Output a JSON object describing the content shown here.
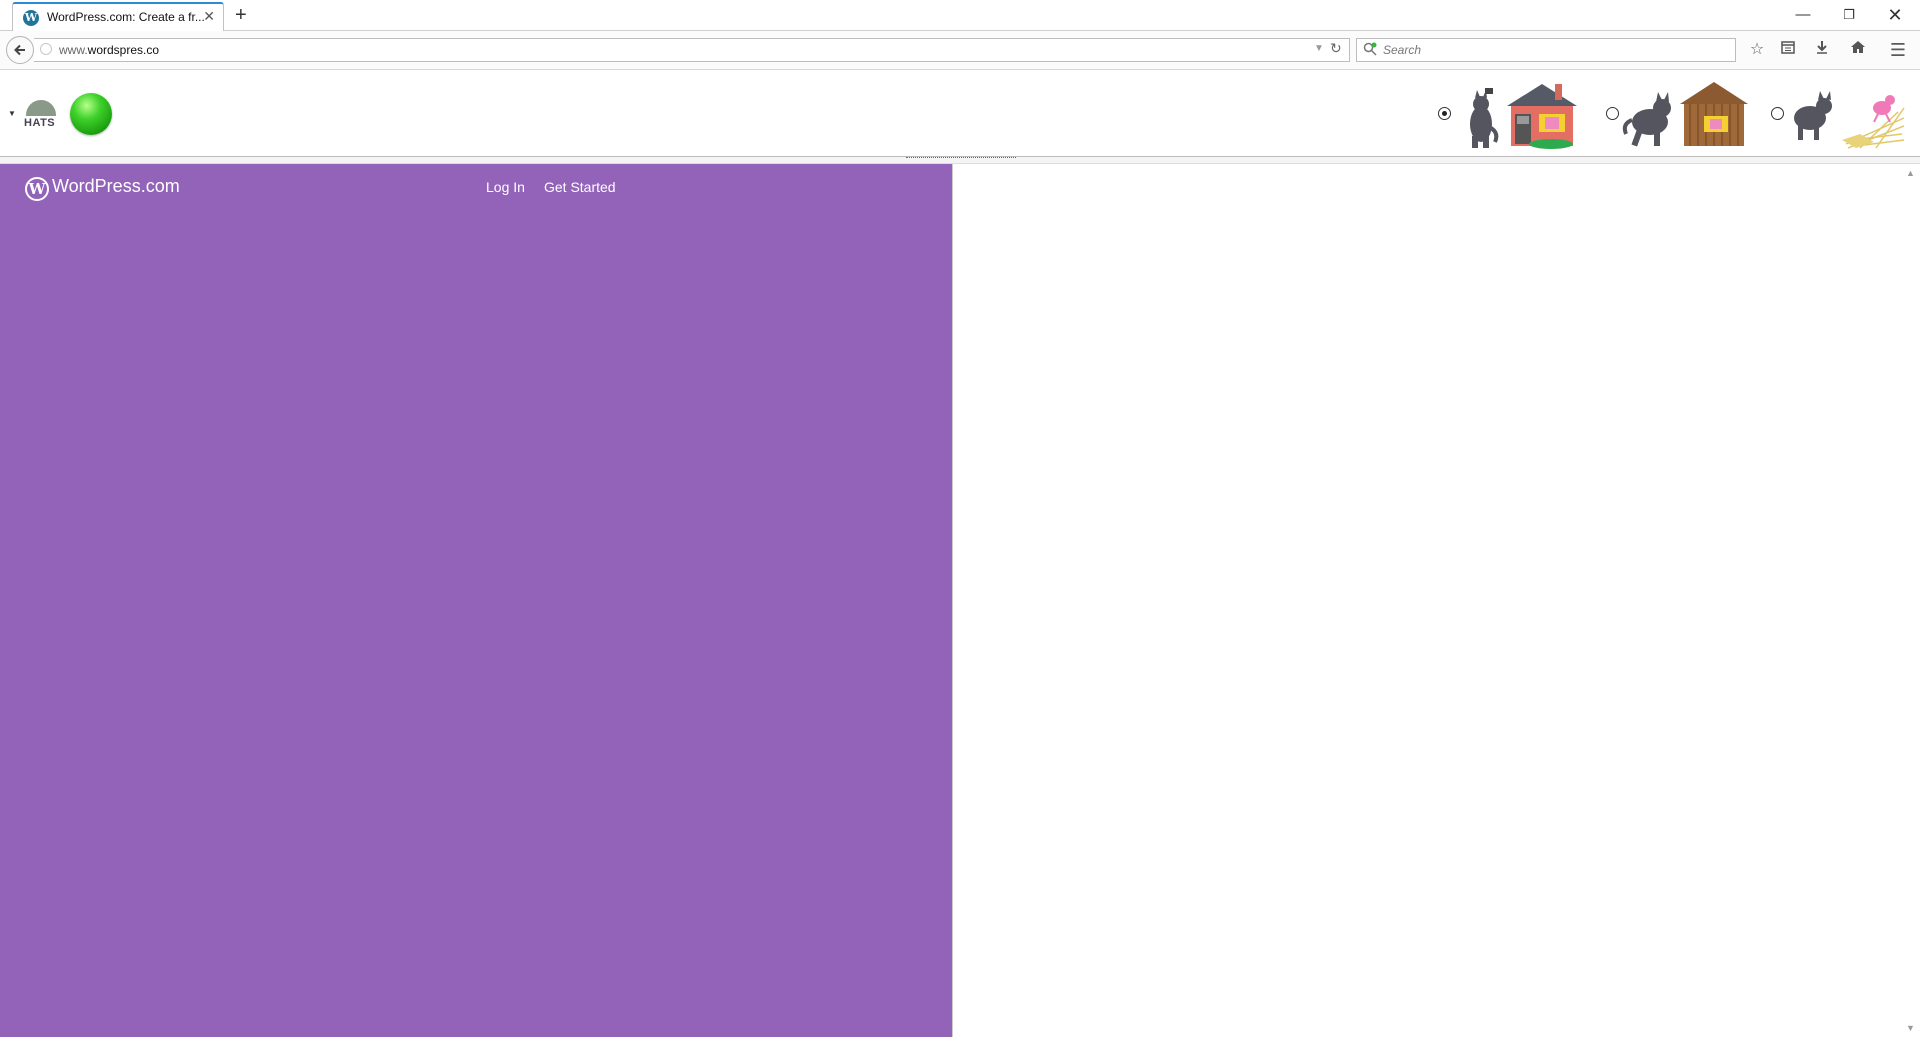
{
  "browser": {
    "tab_title": "WordPress.com: Create a fr...",
    "tab_favicon": "W",
    "tab_close": "✕",
    "new_tab": "+",
    "window_controls": {
      "minimize": "—",
      "restore": "❐",
      "close": "✕"
    },
    "url_prefix": "www.",
    "url_domain": "wordspres.co",
    "search_placeholder": "Search"
  },
  "extension_toolbar": {
    "hats_label": "HATS",
    "scene_options": [
      {
        "name": "wolf-brick-house",
        "selected": true
      },
      {
        "name": "wolf-wood-house",
        "selected": false
      },
      {
        "name": "wolf-straw-house",
        "selected": false
      }
    ]
  },
  "page": {
    "brand": "WordPress.com",
    "logo_letter": "W",
    "nav": {
      "login": "Log In",
      "get_started": "Get Started"
    },
    "left_bg_color": "#9363ba"
  },
  "icons": {
    "back": "back-arrow-icon",
    "reload": "reload-icon",
    "star": "bookmark-star-icon",
    "library": "library-icon",
    "download": "download-icon",
    "home": "home-icon",
    "menu": "hamburger-menu-icon"
  }
}
